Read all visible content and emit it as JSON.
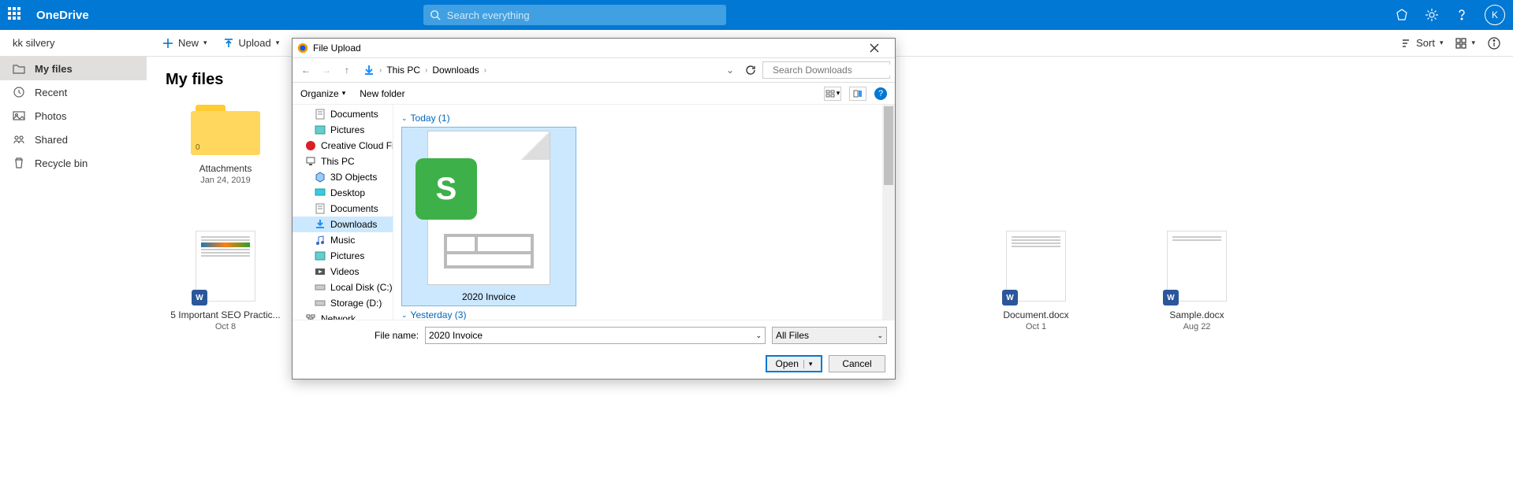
{
  "header": {
    "brand": "OneDrive",
    "search_placeholder": "Search everything",
    "avatar_initial": "K"
  },
  "subbar": {
    "user": "kk silvery",
    "new_label": "New",
    "upload_label": "Upload",
    "sort_label": "Sort"
  },
  "nav": {
    "items": [
      {
        "label": "My files"
      },
      {
        "label": "Recent"
      },
      {
        "label": "Photos"
      },
      {
        "label": "Shared"
      },
      {
        "label": "Recycle bin"
      }
    ]
  },
  "main": {
    "title": "My files",
    "tiles": [
      {
        "type": "folder",
        "name": "Attachments",
        "date": "Jan 24, 2019",
        "count": "0"
      },
      {
        "type": "doc",
        "name": "5 Important SEO Practic...",
        "date": "Oct 8"
      },
      {
        "type": "doc",
        "name": "Document.docx",
        "date": "Oct 1"
      },
      {
        "type": "doc",
        "name": "Sample.docx",
        "date": "Aug 22"
      }
    ]
  },
  "dialog": {
    "title": "File Upload",
    "breadcrumb": [
      "This PC",
      "Downloads"
    ],
    "search_placeholder": "Search Downloads",
    "organize": "Organize",
    "new_folder": "New folder",
    "groups": [
      {
        "label": "Today (1)"
      },
      {
        "label": "Yesterday (3)"
      }
    ],
    "selected_file": "2020 Invoice",
    "tree": [
      {
        "label": "Documents",
        "lvl": 2,
        "icon": "doc"
      },
      {
        "label": "Pictures",
        "lvl": 2,
        "icon": "pic"
      },
      {
        "label": "Creative Cloud Fil",
        "lvl": 1,
        "icon": "cc"
      },
      {
        "label": "This PC",
        "lvl": 1,
        "icon": "pc",
        "expanded": true
      },
      {
        "label": "3D Objects",
        "lvl": 2,
        "icon": "3d"
      },
      {
        "label": "Desktop",
        "lvl": 2,
        "icon": "desk"
      },
      {
        "label": "Documents",
        "lvl": 2,
        "icon": "doc"
      },
      {
        "label": "Downloads",
        "lvl": 2,
        "icon": "dl",
        "selected": true
      },
      {
        "label": "Music",
        "lvl": 2,
        "icon": "music"
      },
      {
        "label": "Pictures",
        "lvl": 2,
        "icon": "pic"
      },
      {
        "label": "Videos",
        "lvl": 2,
        "icon": "vid"
      },
      {
        "label": "Local Disk (C:)",
        "lvl": 2,
        "icon": "disk"
      },
      {
        "label": "Storage (D:)",
        "lvl": 2,
        "icon": "disk"
      },
      {
        "label": "Network",
        "lvl": 1,
        "icon": "net"
      }
    ],
    "filename_label": "File name:",
    "filename_value": "2020 Invoice",
    "filter": "All Files",
    "open": "Open",
    "cancel": "Cancel"
  }
}
